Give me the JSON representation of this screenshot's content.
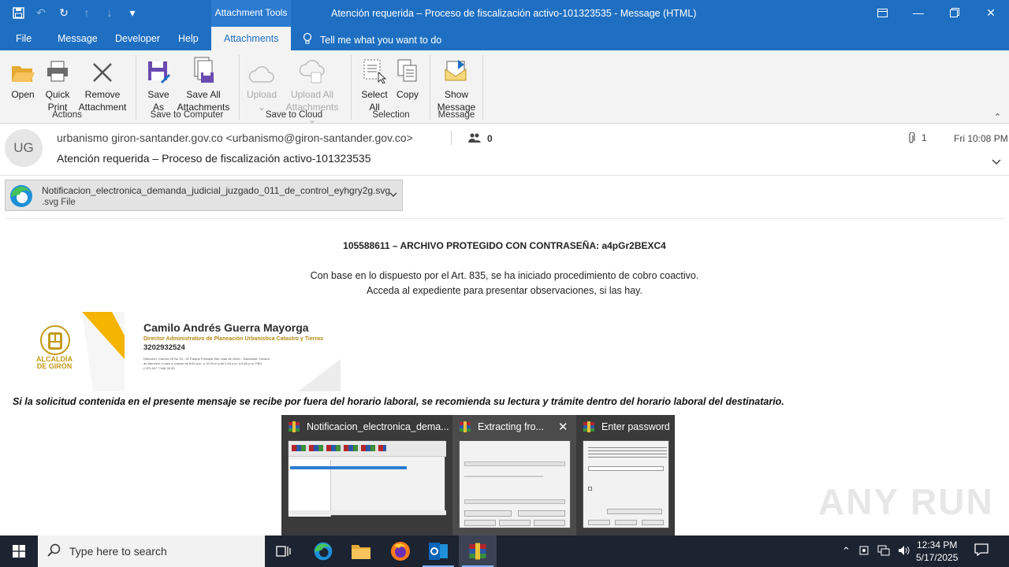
{
  "window": {
    "title": "Atención requerida – Proceso de fiscalización activo-101323535  -  Message (HTML)",
    "context_tab": "Attachment Tools"
  },
  "menu": {
    "tabs": [
      "File",
      "Message",
      "Developer",
      "Help",
      "Attachments"
    ],
    "active_tab": "Attachments",
    "tell_me": "Tell me what you want to do"
  },
  "ribbon": {
    "groups": [
      {
        "label": "Actions",
        "buttons": [
          {
            "line1": "Open",
            "line2": ""
          },
          {
            "line1": "Quick",
            "line2": "Print"
          },
          {
            "line1": "Remove",
            "line2": "Attachment"
          }
        ]
      },
      {
        "label": "Save to Computer",
        "buttons": [
          {
            "line1": "Save",
            "line2": "As"
          },
          {
            "line1": "Save All",
            "line2": "Attachments"
          }
        ]
      },
      {
        "label": "Save to Cloud",
        "buttons": [
          {
            "line1": "Upload",
            "line2": ""
          },
          {
            "line1": "Upload All",
            "line2": "Attachments"
          }
        ]
      },
      {
        "label": "Selection",
        "buttons": [
          {
            "line1": "Select",
            "line2": "All"
          },
          {
            "line1": "Copy",
            "line2": ""
          }
        ]
      },
      {
        "label": "Message",
        "buttons": [
          {
            "line1": "Show",
            "line2": "Message"
          }
        ]
      }
    ]
  },
  "header": {
    "avatar_initials": "UG",
    "from": "urbanismo giron-santander.gov.co <urbanismo@giron-santander.gov.co>",
    "people_count": "0",
    "subject": "Atención requerida – Proceso de fiscalización activo-101323535",
    "attachment_count": "1",
    "date": "Fri 10:08 PM"
  },
  "attachment": {
    "name": "Notificacion_electronica_demanda_judicial_juzgado_011_de_control_eyhgry2g.svg",
    "type": ".svg File"
  },
  "body": {
    "protected_line": "105588611   – ARCHIVO PROTEGIDO CON CONTRASEÑA:  a4pGr2BEXC4",
    "line1": "Con base en lo dispuesto por el Art. 835, se ha iniciado procedimiento de cobro coactivo.",
    "line2": "Acceda al expediente para presentar observaciones, si las hay.",
    "signature": {
      "name": "Camilo Andrés Guerra Mayorga",
      "role": "Director Administrativo de Planeación Urbanística Catastro y Tierras",
      "phone": "3202932524",
      "details": "Dirección: Carrera 25 No 30 - 32 Parque Principal San Juan de Girón - Santander. Horario de Atención: Lunes a Jueves de 8:00 a.m. a 12:00 m y de 2:00 p.m. a 6:00 p.m. PBX: (+57) 607 7 646 30 30",
      "logo_text": "ALCALDÍA DE GIRÓN"
    },
    "disclaimer": "Si la solicitud contenida en el presente mensaje se recibe por fuera del horario laboral, se recomienda su lectura y trámite dentro del horario laboral del destinatario."
  },
  "previews": [
    {
      "title": "Notificacion_electronica_dema..."
    },
    {
      "title": "Extracting fro..."
    },
    {
      "title": "Enter password"
    }
  ],
  "watermark": "ANY RUN",
  "taskbar": {
    "search_placeholder": "Type here to search",
    "time": "12:34 PM",
    "date": "5/17/2025"
  },
  "colors": {
    "accent": "#1e6fc1",
    "taskbar": "#1c2331"
  }
}
